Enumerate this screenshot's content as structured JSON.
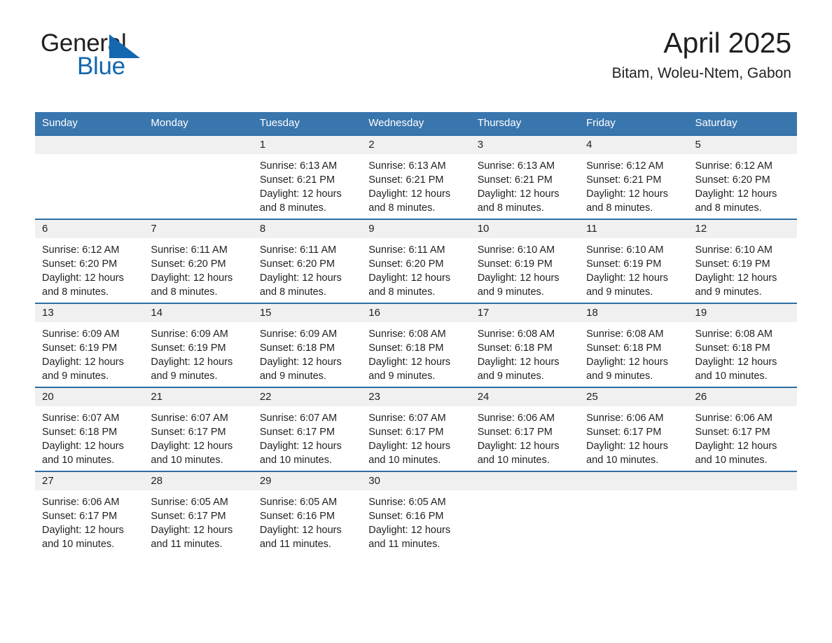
{
  "brand": {
    "name_part1": "General",
    "name_part2": "Blue",
    "triangle_icon": "brand-triangle-icon",
    "colors": {
      "blue": "#1368b0",
      "text": "#231f20"
    }
  },
  "header": {
    "month_title": "April 2025",
    "location": "Bitam, Woleu-Ntem, Gabon"
  },
  "calendar": {
    "header_bg": "#3a76ae",
    "row_divider": "#2e6da4",
    "daynum_band_bg": "#f0f0f0",
    "weekday_headers": [
      "Sunday",
      "Monday",
      "Tuesday",
      "Wednesday",
      "Thursday",
      "Friday",
      "Saturday"
    ],
    "weeks": [
      [
        {
          "day": ""
        },
        {
          "day": ""
        },
        {
          "day": "1",
          "sunrise": "Sunrise: 6:13 AM",
          "sunset": "Sunset: 6:21 PM",
          "daylight_line1": "Daylight: 12 hours",
          "daylight_line2": "and 8 minutes."
        },
        {
          "day": "2",
          "sunrise": "Sunrise: 6:13 AM",
          "sunset": "Sunset: 6:21 PM",
          "daylight_line1": "Daylight: 12 hours",
          "daylight_line2": "and 8 minutes."
        },
        {
          "day": "3",
          "sunrise": "Sunrise: 6:13 AM",
          "sunset": "Sunset: 6:21 PM",
          "daylight_line1": "Daylight: 12 hours",
          "daylight_line2": "and 8 minutes."
        },
        {
          "day": "4",
          "sunrise": "Sunrise: 6:12 AM",
          "sunset": "Sunset: 6:21 PM",
          "daylight_line1": "Daylight: 12 hours",
          "daylight_line2": "and 8 minutes."
        },
        {
          "day": "5",
          "sunrise": "Sunrise: 6:12 AM",
          "sunset": "Sunset: 6:20 PM",
          "daylight_line1": "Daylight: 12 hours",
          "daylight_line2": "and 8 minutes."
        }
      ],
      [
        {
          "day": "6",
          "sunrise": "Sunrise: 6:12 AM",
          "sunset": "Sunset: 6:20 PM",
          "daylight_line1": "Daylight: 12 hours",
          "daylight_line2": "and 8 minutes."
        },
        {
          "day": "7",
          "sunrise": "Sunrise: 6:11 AM",
          "sunset": "Sunset: 6:20 PM",
          "daylight_line1": "Daylight: 12 hours",
          "daylight_line2": "and 8 minutes."
        },
        {
          "day": "8",
          "sunrise": "Sunrise: 6:11 AM",
          "sunset": "Sunset: 6:20 PM",
          "daylight_line1": "Daylight: 12 hours",
          "daylight_line2": "and 8 minutes."
        },
        {
          "day": "9",
          "sunrise": "Sunrise: 6:11 AM",
          "sunset": "Sunset: 6:20 PM",
          "daylight_line1": "Daylight: 12 hours",
          "daylight_line2": "and 8 minutes."
        },
        {
          "day": "10",
          "sunrise": "Sunrise: 6:10 AM",
          "sunset": "Sunset: 6:19 PM",
          "daylight_line1": "Daylight: 12 hours",
          "daylight_line2": "and 9 minutes."
        },
        {
          "day": "11",
          "sunrise": "Sunrise: 6:10 AM",
          "sunset": "Sunset: 6:19 PM",
          "daylight_line1": "Daylight: 12 hours",
          "daylight_line2": "and 9 minutes."
        },
        {
          "day": "12",
          "sunrise": "Sunrise: 6:10 AM",
          "sunset": "Sunset: 6:19 PM",
          "daylight_line1": "Daylight: 12 hours",
          "daylight_line2": "and 9 minutes."
        }
      ],
      [
        {
          "day": "13",
          "sunrise": "Sunrise: 6:09 AM",
          "sunset": "Sunset: 6:19 PM",
          "daylight_line1": "Daylight: 12 hours",
          "daylight_line2": "and 9 minutes."
        },
        {
          "day": "14",
          "sunrise": "Sunrise: 6:09 AM",
          "sunset": "Sunset: 6:19 PM",
          "daylight_line1": "Daylight: 12 hours",
          "daylight_line2": "and 9 minutes."
        },
        {
          "day": "15",
          "sunrise": "Sunrise: 6:09 AM",
          "sunset": "Sunset: 6:18 PM",
          "daylight_line1": "Daylight: 12 hours",
          "daylight_line2": "and 9 minutes."
        },
        {
          "day": "16",
          "sunrise": "Sunrise: 6:08 AM",
          "sunset": "Sunset: 6:18 PM",
          "daylight_line1": "Daylight: 12 hours",
          "daylight_line2": "and 9 minutes."
        },
        {
          "day": "17",
          "sunrise": "Sunrise: 6:08 AM",
          "sunset": "Sunset: 6:18 PM",
          "daylight_line1": "Daylight: 12 hours",
          "daylight_line2": "and 9 minutes."
        },
        {
          "day": "18",
          "sunrise": "Sunrise: 6:08 AM",
          "sunset": "Sunset: 6:18 PM",
          "daylight_line1": "Daylight: 12 hours",
          "daylight_line2": "and 9 minutes."
        },
        {
          "day": "19",
          "sunrise": "Sunrise: 6:08 AM",
          "sunset": "Sunset: 6:18 PM",
          "daylight_line1": "Daylight: 12 hours",
          "daylight_line2": "and 10 minutes."
        }
      ],
      [
        {
          "day": "20",
          "sunrise": "Sunrise: 6:07 AM",
          "sunset": "Sunset: 6:18 PM",
          "daylight_line1": "Daylight: 12 hours",
          "daylight_line2": "and 10 minutes."
        },
        {
          "day": "21",
          "sunrise": "Sunrise: 6:07 AM",
          "sunset": "Sunset: 6:17 PM",
          "daylight_line1": "Daylight: 12 hours",
          "daylight_line2": "and 10 minutes."
        },
        {
          "day": "22",
          "sunrise": "Sunrise: 6:07 AM",
          "sunset": "Sunset: 6:17 PM",
          "daylight_line1": "Daylight: 12 hours",
          "daylight_line2": "and 10 minutes."
        },
        {
          "day": "23",
          "sunrise": "Sunrise: 6:07 AM",
          "sunset": "Sunset: 6:17 PM",
          "daylight_line1": "Daylight: 12 hours",
          "daylight_line2": "and 10 minutes."
        },
        {
          "day": "24",
          "sunrise": "Sunrise: 6:06 AM",
          "sunset": "Sunset: 6:17 PM",
          "daylight_line1": "Daylight: 12 hours",
          "daylight_line2": "and 10 minutes."
        },
        {
          "day": "25",
          "sunrise": "Sunrise: 6:06 AM",
          "sunset": "Sunset: 6:17 PM",
          "daylight_line1": "Daylight: 12 hours",
          "daylight_line2": "and 10 minutes."
        },
        {
          "day": "26",
          "sunrise": "Sunrise: 6:06 AM",
          "sunset": "Sunset: 6:17 PM",
          "daylight_line1": "Daylight: 12 hours",
          "daylight_line2": "and 10 minutes."
        }
      ],
      [
        {
          "day": "27",
          "sunrise": "Sunrise: 6:06 AM",
          "sunset": "Sunset: 6:17 PM",
          "daylight_line1": "Daylight: 12 hours",
          "daylight_line2": "and 10 minutes."
        },
        {
          "day": "28",
          "sunrise": "Sunrise: 6:05 AM",
          "sunset": "Sunset: 6:17 PM",
          "daylight_line1": "Daylight: 12 hours",
          "daylight_line2": "and 11 minutes."
        },
        {
          "day": "29",
          "sunrise": "Sunrise: 6:05 AM",
          "sunset": "Sunset: 6:16 PM",
          "daylight_line1": "Daylight: 12 hours",
          "daylight_line2": "and 11 minutes."
        },
        {
          "day": "30",
          "sunrise": "Sunrise: 6:05 AM",
          "sunset": "Sunset: 6:16 PM",
          "daylight_line1": "Daylight: 12 hours",
          "daylight_line2": "and 11 minutes."
        },
        {
          "day": ""
        },
        {
          "day": ""
        },
        {
          "day": ""
        }
      ]
    ]
  }
}
